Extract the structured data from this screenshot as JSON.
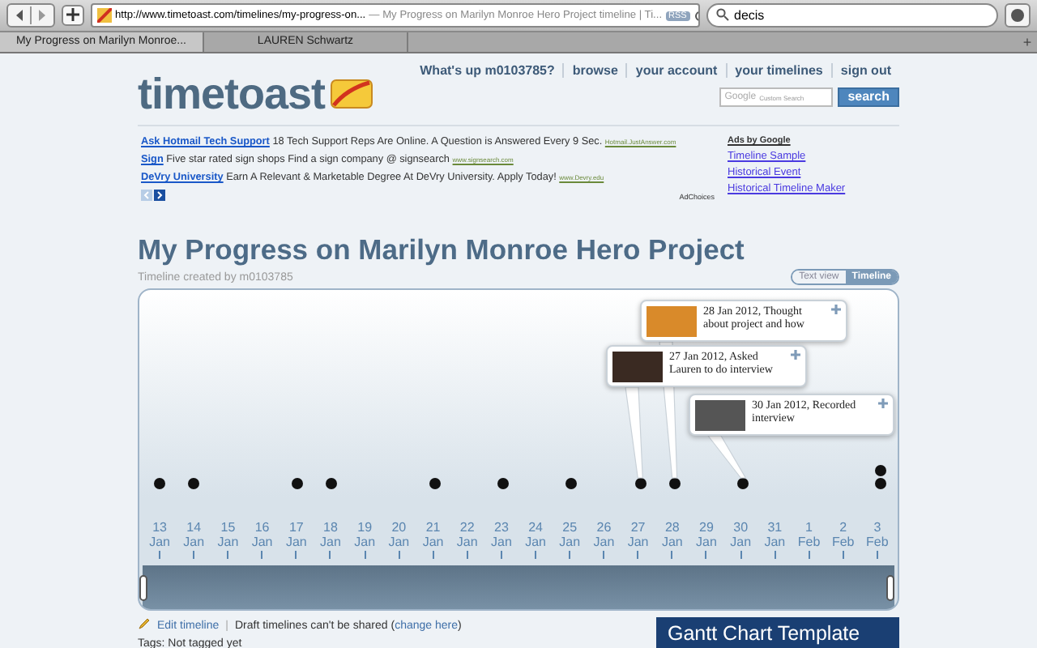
{
  "browser": {
    "url": "http://www.timetoast.com/timelines/my-progress-on...",
    "page_title": "— My Progress on Marilyn Monroe Hero Project timeline | Ti...",
    "rss": "RSS",
    "search": "decis",
    "tabs": [
      {
        "label": "My Progress on Marilyn Monroe...",
        "selected": true
      },
      {
        "label": "LAUREN Schwartz",
        "selected": false
      }
    ],
    "new_tab": "+"
  },
  "site": {
    "logo": "timetoast",
    "nav": [
      "What's up m0103785?",
      "browse",
      "your account",
      "your timelines",
      "sign out"
    ],
    "search_brand": "Google",
    "search_placeholder": "Custom Search",
    "search_button": "search"
  },
  "ads": [
    {
      "link": "Ask Hotmail Tech Support",
      "text": "18 Tech Support Reps Are Online. A Question is Answered Every 9 Sec.",
      "url": "Hotmail.JustAnswer.com"
    },
    {
      "link": "Sign",
      "text": "Five star rated sign shops Find a sign company @ signsearch",
      "url": "www.signsearch.com"
    },
    {
      "link": "DeVry University",
      "text": "Earn A Relevant & Marketable Degree At DeVry University. Apply Today!",
      "url": "www.Devry.edu"
    }
  ],
  "ad_choices": "AdChoices",
  "ads_by": "Ads by Google",
  "ad_links": [
    "Timeline Sample",
    "Historical Event",
    "Historical Timeline Maker"
  ],
  "timeline": {
    "title": "My Progress on Marilyn Monroe Hero Project",
    "subtitle": "Timeline created by m0103785",
    "views": [
      {
        "label": "Text view",
        "selected": false
      },
      {
        "label": "Timeline",
        "selected": true
      }
    ],
    "cards": [
      {
        "text": "28 Jan 2012, Thought about project and how"
      },
      {
        "text": "27 Jan 2012, Asked Lauren to do interview"
      },
      {
        "text": "30 Jan 2012, Recorded interview"
      }
    ],
    "dates": [
      {
        "day": "13",
        "month": "Jan",
        "events": [
          {
            "kind": "dot"
          }
        ]
      },
      {
        "day": "14",
        "month": "Jan",
        "events": [
          {
            "kind": "dot"
          }
        ]
      },
      {
        "day": "15",
        "month": "Jan"
      },
      {
        "day": "16",
        "month": "Jan"
      },
      {
        "day": "17",
        "month": "Jan",
        "events": [
          {
            "kind": "dot"
          }
        ]
      },
      {
        "day": "18",
        "month": "Jan",
        "events": [
          {
            "kind": "dot"
          }
        ]
      },
      {
        "day": "19",
        "month": "Jan"
      },
      {
        "day": "20",
        "month": "Jan"
      },
      {
        "day": "21",
        "month": "Jan",
        "events": [
          {
            "kind": "dot"
          }
        ]
      },
      {
        "day": "22",
        "month": "Jan"
      },
      {
        "day": "23",
        "month": "Jan",
        "events": [
          {
            "kind": "dot"
          }
        ]
      },
      {
        "day": "24",
        "month": "Jan"
      },
      {
        "day": "25",
        "month": "Jan",
        "events": [
          {
            "kind": "dot"
          }
        ]
      },
      {
        "day": "26",
        "month": "Jan"
      },
      {
        "day": "27",
        "month": "Jan",
        "events": [
          {
            "kind": "dot"
          }
        ]
      },
      {
        "day": "28",
        "month": "Jan",
        "events": [
          {
            "kind": "dot"
          }
        ]
      },
      {
        "day": "29",
        "month": "Jan"
      },
      {
        "day": "30",
        "month": "Jan",
        "events": [
          {
            "kind": "dot"
          }
        ]
      },
      {
        "day": "31",
        "month": "Jan"
      },
      {
        "day": "1",
        "month": "Feb"
      },
      {
        "day": "2",
        "month": "Feb"
      },
      {
        "day": "3",
        "month": "Feb",
        "events": [
          {
            "kind": "dot"
          },
          {
            "kind": "dot"
          }
        ]
      }
    ]
  },
  "footer": {
    "edit": "Edit timeline",
    "separator": "|",
    "draft_before": "Draft timelines can't be shared (",
    "draft_link": "change here",
    "draft_after": ")",
    "tags": "Tags: Not tagged yet",
    "banner": "Gantt Chart Template"
  }
}
